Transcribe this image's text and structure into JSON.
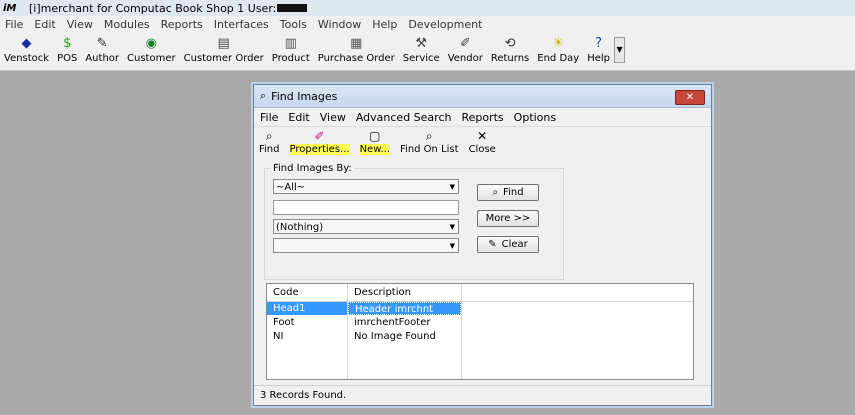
{
  "app": {
    "logo": "iM",
    "title": "[i]merchant for Computac Book Shop 1 User:",
    "menu": [
      "File",
      "Edit",
      "View",
      "Modules",
      "Reports",
      "Interfaces",
      "Tools",
      "Window",
      "Help",
      "Development"
    ]
  },
  "toolbar": [
    {
      "label": "Venstock",
      "icon": "diamond-icon",
      "glyph": "◆",
      "color": "#1b2f9c"
    },
    {
      "label": "POS",
      "icon": "dollar-icon",
      "glyph": "$",
      "color": "#18a21a"
    },
    {
      "label": "Author",
      "icon": "author-icon",
      "glyph": "✎",
      "color": "#333333"
    },
    {
      "label": "Customer",
      "icon": "globe-icon",
      "glyph": "◉",
      "color": "#1d7e2c"
    },
    {
      "label": "Customer Order",
      "icon": "register-icon",
      "glyph": "▤",
      "color": "#444444"
    },
    {
      "label": "Product",
      "icon": "product-icon",
      "glyph": "▥",
      "color": "#555555"
    },
    {
      "label": "Purchase Order",
      "icon": "order-form-icon",
      "glyph": "▦",
      "color": "#555555"
    },
    {
      "label": "Service",
      "icon": "wrench-icon",
      "glyph": "⚒",
      "color": "#444444"
    },
    {
      "label": "Vendor",
      "icon": "vendor-icon",
      "glyph": "✐",
      "color": "#444444"
    },
    {
      "label": "Returns",
      "icon": "returns-icon",
      "glyph": "⟲",
      "color": "#333333"
    },
    {
      "label": "End Day",
      "icon": "sun-icon",
      "glyph": "☀",
      "color": "#d4b300"
    },
    {
      "label": "Help",
      "icon": "help-icon",
      "glyph": "?",
      "color": "#1a3fa0"
    }
  ],
  "window": {
    "title": "Find Images",
    "close_glyph": "✕",
    "menu": [
      "File",
      "Edit",
      "View",
      "Advanced Search",
      "Reports",
      "Options"
    ],
    "tools": [
      {
        "label": "Find",
        "icon": "binoculars-icon",
        "glyph": "⌕",
        "highlight": false
      },
      {
        "label": "Properties...",
        "icon": "properties-icon",
        "glyph": "✐",
        "highlight": true
      },
      {
        "label": "New...",
        "icon": "new-document-icon",
        "glyph": "▢",
        "highlight": true
      },
      {
        "label": "Find On List",
        "icon": "binoculars-list-icon",
        "glyph": "⌕",
        "highlight": false
      },
      {
        "label": "Close",
        "icon": "close-icon",
        "glyph": "✕",
        "highlight": false
      }
    ],
    "find_group_label": "Find Images By:",
    "select1": "~All~",
    "text1": "",
    "select2": "(Nothing)",
    "select3": "",
    "buttons": {
      "find": "Find",
      "more": "More >>",
      "clear": "Clear"
    },
    "grid": {
      "columns": [
        "Code",
        "Description"
      ],
      "rows": [
        {
          "code": "Head1",
          "description": "Header imrchnt",
          "selected": true
        },
        {
          "code": "Foot",
          "description": "imrchentFooter",
          "selected": false
        },
        {
          "code": "NI",
          "description": "No Image Found",
          "selected": false
        }
      ]
    },
    "status": "3 Records Found."
  }
}
